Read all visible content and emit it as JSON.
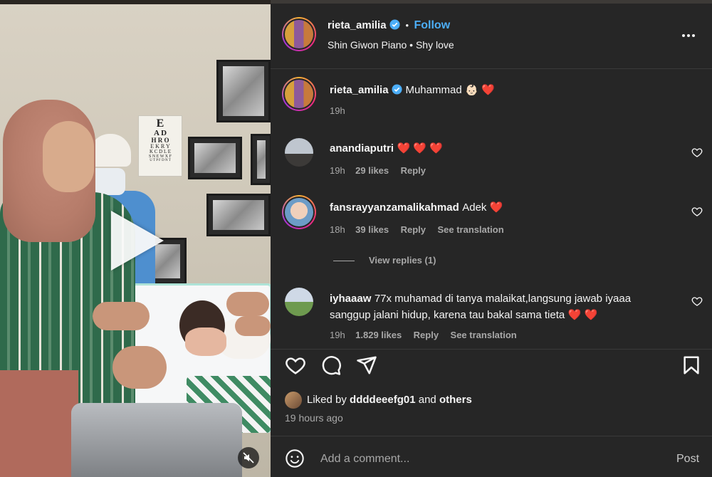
{
  "post": {
    "username": "rieta_amilia",
    "follow_label": "Follow",
    "separator": "•",
    "audio": "Shin Giwon Piano • Shy love"
  },
  "caption": {
    "username": "rieta_amilia",
    "text": "Muhammad",
    "emoji": "👶🏻 ❤️",
    "time": "19h"
  },
  "comments": [
    {
      "username": "anandiaputri",
      "text": "",
      "emoji": "❤️ ❤️ ❤️",
      "time": "19h",
      "likes": "29 likes",
      "reply": "Reply"
    },
    {
      "username": "fansrayyanzamalikahmad",
      "text": "Adek",
      "emoji": "❤️",
      "time": "18h",
      "likes": "39 likes",
      "reply": "Reply",
      "translation": "See translation",
      "view_replies": "View replies (1)"
    },
    {
      "username": "iyhaaaw",
      "text_line1": "77x muhamad di tanya malaikat,langsung jawab iyaaa",
      "text_line2": "sanggup jalani hidup, karena tau bakal sama tieta",
      "emoji": "❤️ ❤️",
      "time": "19h",
      "likes": "1.829 likes",
      "reply": "Reply",
      "translation": "See translation"
    }
  ],
  "likes_summary": {
    "prefix": "Liked by",
    "user": "ddddeeefg01",
    "connector": "and",
    "others": "others",
    "time": "19 hours ago"
  },
  "composer": {
    "placeholder": "Add a comment...",
    "post_label": "Post"
  },
  "icons": [
    "play-icon",
    "mute-icon",
    "verified-icon",
    "more-icon",
    "heart-icon",
    "comment-icon",
    "share-icon",
    "bookmark-icon",
    "emoji-icon"
  ],
  "colors": {
    "accent_blue": "#4caef8",
    "panel_bg": "#262626",
    "heart": "#ff3b6b"
  },
  "eye_chart": [
    "E",
    "A D",
    "H R O",
    "E K R Y",
    "K C D L E",
    "S N E W X F",
    "U T P F D N T"
  ]
}
